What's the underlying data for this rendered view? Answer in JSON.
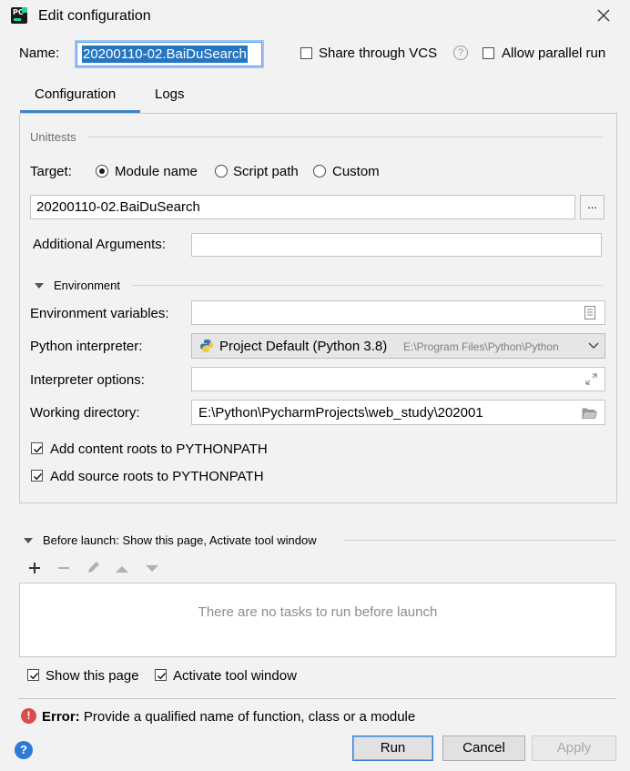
{
  "window": {
    "title": "Edit configuration",
    "app_icon_text": "PC"
  },
  "header": {
    "name_label": "Name:",
    "name_value": "20200110-02.BaiDuSearch",
    "share_vcs_label": "Share through VCS",
    "share_vcs_checked": false,
    "help_glyph": "?",
    "allow_parallel_label": "Allow parallel run",
    "allow_parallel_checked": false
  },
  "tabs": [
    {
      "label": "Configuration",
      "active": true
    },
    {
      "label": "Logs",
      "active": false
    }
  ],
  "unittests": {
    "section_label": "Unittests",
    "target_label": "Target:",
    "target_options": [
      {
        "label": "Module name",
        "selected": true
      },
      {
        "label": "Script path",
        "selected": false
      },
      {
        "label": "Custom",
        "selected": false
      }
    ],
    "module_value": "20200110-02.BaiDuSearch",
    "browse_label": "...",
    "additional_args_label": "Additional Arguments:",
    "additional_args_value": ""
  },
  "environment": {
    "section_label": "Environment",
    "env_vars_label": "Environment variables:",
    "env_vars_value": "",
    "interpreter_label": "Python interpreter:",
    "interpreter_value": "Project Default (Python 3.8)",
    "interpreter_path": "E:\\Program Files\\Python\\Python",
    "interpreter_options_label": "Interpreter options:",
    "interpreter_options_value": "",
    "working_dir_label": "Working directory:",
    "working_dir_value": "E:\\Python\\PycharmProjects\\web_study\\202001",
    "content_roots_label": "Add content roots to PYTHONPATH",
    "content_roots_checked": true,
    "source_roots_label": "Add source roots to PYTHONPATH",
    "source_roots_checked": true
  },
  "before_launch": {
    "label": "Before launch: Show this page, Activate tool window",
    "empty_text": "There are no tasks to run before launch",
    "toolbar_icons": [
      "add-icon",
      "remove-icon",
      "edit-icon",
      "move-up-icon",
      "move-down-icon"
    ]
  },
  "footer": {
    "show_page_label": "Show this page",
    "show_page_checked": true,
    "activate_tool_label": "Activate tool window",
    "activate_tool_checked": true,
    "error_prefix": "Error:",
    "error_message": "Provide a qualified name of function, class or a module",
    "error_glyph": "!",
    "help_glyph": "?",
    "run_label": "Run",
    "cancel_label": "Cancel",
    "apply_label": "Apply"
  },
  "colors": {
    "accent": "#4083c9",
    "selection": "#2675bf",
    "error": "#d94c4c",
    "help": "#2e7bd5"
  }
}
